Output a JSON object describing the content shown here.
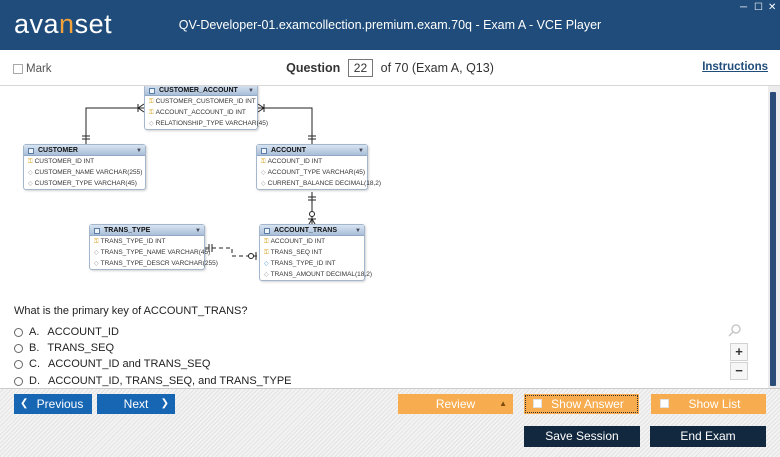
{
  "window": {
    "brand_prefix": "ava",
    "brand_accent": "n",
    "brand_suffix": "set",
    "title": "QV-Developer-01.examcollection.premium.exam.70q - Exam A - VCE Player",
    "minimize": "─",
    "maximize": "☐",
    "close": "✕"
  },
  "header": {
    "mark_label": "Mark",
    "question_label": "Question",
    "question_number": "22",
    "question_suffix": "of 70 (Exam A, Q13)",
    "instructions_label": "Instructions"
  },
  "diagram": {
    "tables": {
      "customer_account": {
        "name": "CUSTOMER_ACCOUNT",
        "fields": [
          "CUSTOMER_CUSTOMER_ID INT",
          "ACCOUNT_ACCOUNT_ID INT",
          "RELATIONSHIP_TYPE VARCHAR(45)"
        ]
      },
      "customer": {
        "name": "CUSTOMER",
        "fields": [
          "CUSTOMER_ID INT",
          "CUSTOMER_NAME VARCHAR(255)",
          "CUSTOMER_TYPE VARCHAR(45)"
        ]
      },
      "account": {
        "name": "ACCOUNT",
        "fields": [
          "ACCOUNT_ID INT",
          "ACCOUNT_TYPE VARCHAR(45)",
          "CURRENT_BALANCE DECIMAL(18,2)"
        ]
      },
      "trans_type": {
        "name": "TRANS_TYPE",
        "fields": [
          "TRANS_TYPE_ID INT",
          "TRANS_TYPE_NAME VARCHAR(45)",
          "TRANS_TYPE_DESCR VARCHAR(255)"
        ]
      },
      "account_trans": {
        "name": "ACCOUNT_TRANS",
        "fields": [
          "ACCOUNT_ID INT",
          "TRANS_SEQ INT",
          "TRANS_TYPE_ID INT",
          "TRANS_AMOUNT DECIMAL(18,2)"
        ]
      }
    },
    "key_glyph": "⚿",
    "diamond_glyph": "◇",
    "dropdown_glyph": "▼"
  },
  "question": {
    "text": "What is the primary key of ACCOUNT_TRANS?",
    "options": [
      {
        "letter": "A.",
        "text": "ACCOUNT_ID"
      },
      {
        "letter": "B.",
        "text": "TRANS_SEQ"
      },
      {
        "letter": "C.",
        "text": "ACCOUNT_ID and TRANS_SEQ"
      },
      {
        "letter": "D.",
        "text": "ACCOUNT_ID, TRANS_SEQ, and TRANS_TYPE"
      }
    ]
  },
  "zoom": {
    "in": "+",
    "out": "−"
  },
  "nav": {
    "previous": "Previous",
    "next": "Next",
    "review": "Review",
    "show_answer": "Show Answer",
    "show_list": "Show List",
    "save_session": "Save Session",
    "end_exam": "End Exam"
  },
  "colors": {
    "titlebar": "#1f4c7a",
    "brand_accent": "#f2a23b",
    "nav_blue": "#1766b4",
    "option_orange": "#f6ac4f",
    "dark_button": "#12283f"
  }
}
